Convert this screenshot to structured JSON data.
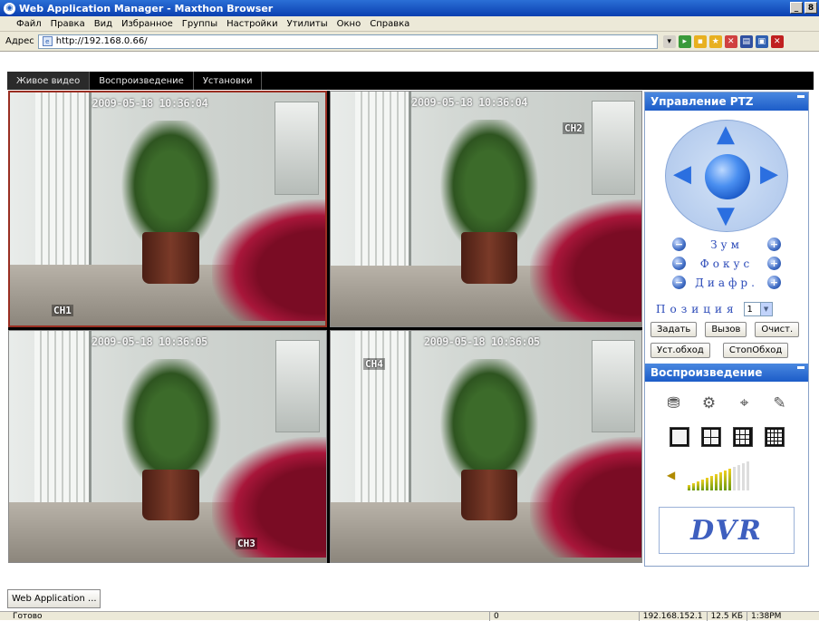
{
  "window": {
    "title": "Web Application Manager - Maxthon Browser",
    "buttons": [
      "_",
      "8"
    ]
  },
  "menu": [
    "Файл",
    "Правка",
    "Вид",
    "Избранное",
    "Группы",
    "Настройки",
    "Утилиты",
    "Окно",
    "Справка"
  ],
  "address": {
    "label": "Адрес",
    "url": "http://192.168.0.66/"
  },
  "nav": {
    "tabs": [
      "Живое видео",
      "Воспроизведение",
      "Установки"
    ]
  },
  "cameras": [
    {
      "timestamp": "2009-05-18 10:36:04",
      "label": "CH1"
    },
    {
      "timestamp": "2009-05-18 10:36:04",
      "label": "CH2"
    },
    {
      "timestamp": "2009-05-18 10:36:05",
      "label": "CH3"
    },
    {
      "timestamp": "2009-05-18 10:36:05",
      "label": "CH4"
    }
  ],
  "ptz": {
    "title": "Управление PTZ",
    "zoom": "Зум",
    "focus": "Фокус",
    "iris": "Диафр.",
    "position_label": "Позиция",
    "position_value": "1",
    "set_btn": "Задать",
    "call_btn": "Вызов",
    "clear_btn": "Очист.",
    "tour_btn": "Уст.обход",
    "stop_tour_btn": "СтопОбход"
  },
  "playback": {
    "title": "Воспроизведение",
    "icons": [
      "record-icon",
      "snapshot-icon",
      "camera-icon",
      "audio-icon"
    ],
    "logo": "DVR"
  },
  "volume_level": 0.7,
  "taskbar": {
    "app": "Web Application ..."
  },
  "status": {
    "left": "Готово",
    "count": "0",
    "ip": "192.168.152.1",
    "speed": "12.5 КБ",
    "time": "1:38PM"
  },
  "colors": {
    "titlebar": "#0a3fb0",
    "selection": "#9a2e22",
    "panel_header": "#1c5cc8",
    "chair": "#a8163a"
  }
}
